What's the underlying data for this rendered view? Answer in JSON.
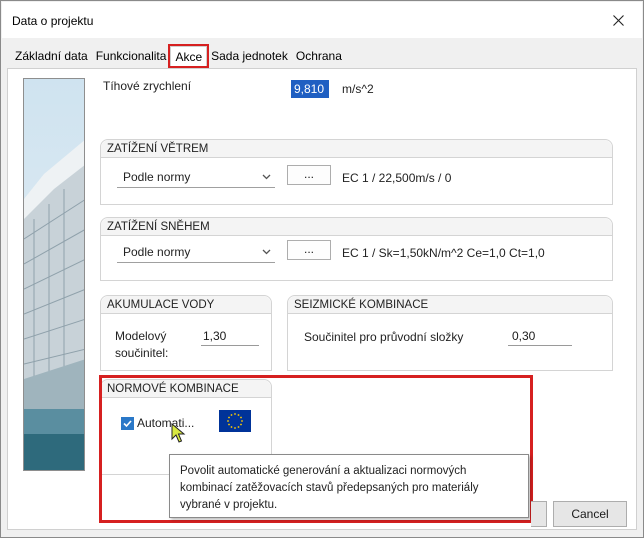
{
  "window": {
    "title": "Data o projektu"
  },
  "tabs": [
    {
      "label": "Základní data"
    },
    {
      "label": "Funkcionalita"
    },
    {
      "label": "Akce"
    },
    {
      "label": "Sada jednotek"
    },
    {
      "label": "Ochrana"
    }
  ],
  "gravity": {
    "label": "Tíhové zrychlení",
    "value": "9,810",
    "unit": "m/s^2"
  },
  "wind": {
    "header": "ZATÍŽENÍ VĚTREM",
    "select_value": "Podle normy",
    "button_label": "...",
    "summary": "EC 1 / 22,500m/s / 0"
  },
  "snow": {
    "header": "ZATÍŽENÍ SNĚHEM",
    "select_value": "Podle normy",
    "button_label": "...",
    "summary": "EC 1 / Sk=1,50kN/m^2 Ce=1,0 Ct=1,0"
  },
  "water": {
    "header": "AKUMULACE VODY",
    "label_line1": "Modelový",
    "label_line2": "součinitel:",
    "value": "1,30"
  },
  "seismic": {
    "header": "SEIZMICKÉ KOMBINACE",
    "label": "Součinitel pro průvodní složky",
    "value": "0,30"
  },
  "norm_combinations": {
    "header": "NORMOVÉ KOMBINACE",
    "checkbox_label": "Automati...",
    "checked": true,
    "flag_icon": "eu-flag-icon"
  },
  "tooltip": {
    "line1": "Povolit automatické generování a aktualizaci normových",
    "line2": "kombinací zatěžovacích stavů předepsaných pro materiály",
    "line3": "vybrané v projektu."
  },
  "buttons": {
    "cancel": "Cancel"
  },
  "colors": {
    "highlight": "#d62020",
    "selection": "#1f5fc2",
    "eu_blue": "#003399",
    "eu_star": "#ffcc00"
  }
}
